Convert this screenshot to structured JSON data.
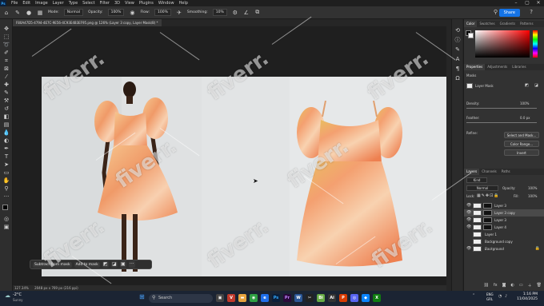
{
  "app": {
    "logo": "Ps",
    "menu": [
      "File",
      "Edit",
      "Image",
      "Layer",
      "Type",
      "Select",
      "Filter",
      "3D",
      "View",
      "Plugins",
      "Window",
      "Help"
    ],
    "window_controls": [
      "–",
      "▢",
      "✕"
    ]
  },
  "options_bar": {
    "mode_label": "Mode:",
    "mode_value": "Normal",
    "opacity_label": "Opacity:",
    "opacity_value": "100%",
    "flow_label": "Flow:",
    "flow_value": "100%",
    "smoothing_label": "Smoothing:",
    "smoothing_value": "10%",
    "share_label": "Share"
  },
  "document": {
    "tab_title": "F80A47D5-4794-4E7C-9E56-4C93E4B3EF95.png @ 126% (Layer 3 copy, Layer Mask/8) *",
    "status": "127.34%",
    "status_dims": "2048 px x 769 px (216 ppi)"
  },
  "context_bar": {
    "subtract_label": "Subtract from mask",
    "add_label": "Add to mask",
    "more": "···"
  },
  "color_panel": {
    "tabs": [
      "Color",
      "Swatches",
      "Gradients",
      "Patterns"
    ],
    "fg": "#000000",
    "bg": "#ffffff"
  },
  "properties_panel": {
    "tabs": [
      "Properties",
      "Adjustments",
      "Libraries"
    ],
    "section": "Masks",
    "mask_label": "Layer Mask",
    "density_label": "Density:",
    "density_value": "100%",
    "feather_label": "Feather:",
    "feather_value": "0.0 px",
    "refine_label": "Refine:",
    "select_mask_btn": "Select and Mask...",
    "color_range_btn": "Color Range...",
    "invert_btn": "Invert"
  },
  "layers_panel": {
    "tabs": [
      "Layers",
      "Channels",
      "Paths"
    ],
    "kind_label": "Kind",
    "blend_mode": "Normal",
    "opacity_label": "Opacity:",
    "opacity_value": "100%",
    "lock_label": "Lock:",
    "fill_label": "Fill:",
    "fill_value": "100%",
    "layers": [
      {
        "name": "Layer 3",
        "selected": false,
        "mask": true
      },
      {
        "name": "Layer 3 copy",
        "selected": true,
        "mask": true
      },
      {
        "name": "Layer 3",
        "selected": false,
        "mask": true
      },
      {
        "name": "Layer 4",
        "selected": false,
        "mask": true
      },
      {
        "name": "Layer 1",
        "selected": false,
        "mask": false
      },
      {
        "name": "Background copy",
        "selected": false,
        "mask": false
      },
      {
        "name": "Background",
        "selected": false,
        "mask": false
      }
    ]
  },
  "watermark": "fiverr.",
  "taskbar": {
    "weather_temp": "-2°C",
    "weather_desc": "Sunny",
    "search_placeholder": "Search",
    "lang_top": "ENG",
    "lang_bottom": "GRL",
    "time": "1:16 PM",
    "date": "11/04/2025"
  },
  "colors": {
    "accent": "#1473e6",
    "dress_main": "#f0a070",
    "dress_light": "#f8d2b0",
    "dress_yellow": "#e8c060"
  }
}
